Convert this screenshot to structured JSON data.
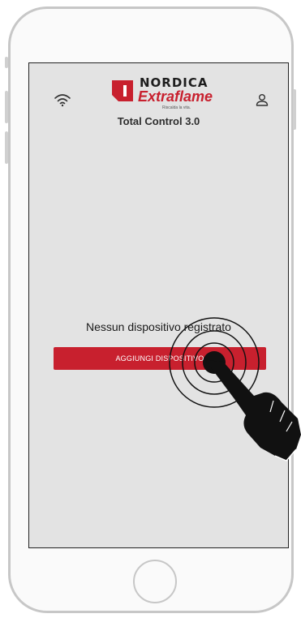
{
  "app": {
    "brand_name": "NORDICA",
    "brand_sub": "Extraflame",
    "brand_tagline": "Riscalda la vita.",
    "title": "Total Control 3.0"
  },
  "icons": {
    "wifi": "wifi-icon",
    "profile": "user-profile-icon",
    "tap": "hand-tap-gesture-icon"
  },
  "main": {
    "empty_message": "Nessun dispositivo registrato",
    "add_button_label": "AGGIUNGI DISPOSITIVO"
  },
  "colors": {
    "brand_red": "#c8202e",
    "screen_bg": "#e3e3e3",
    "text_dark": "#1a1a1a"
  }
}
